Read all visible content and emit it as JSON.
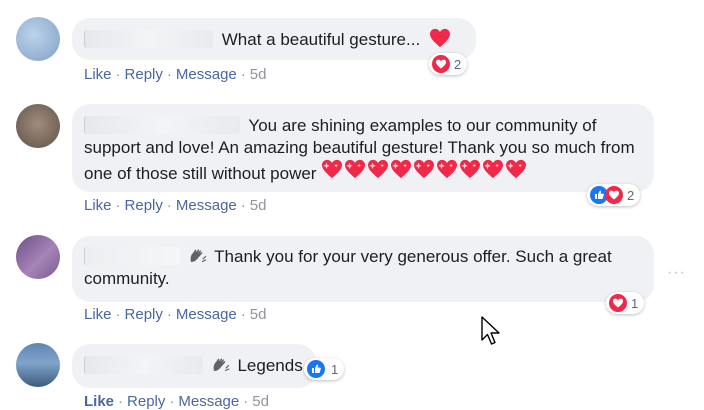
{
  "comments": [
    {
      "text": "What a beautiful gesture...",
      "actions": {
        "like": "Like",
        "reply": "Reply",
        "message": "Message",
        "time": "5d"
      },
      "reaction_count": "2"
    },
    {
      "text": "You are shining examples to our community of support and love! An amazing beautiful gesture! Thank you so much from one of those still without power",
      "actions": {
        "like": "Like",
        "reply": "Reply",
        "message": "Message",
        "time": "5d"
      },
      "reaction_count": "2"
    },
    {
      "text": "Thank you for your very generous offer. Such a great community.",
      "actions": {
        "like": "Like",
        "reply": "Reply",
        "message": "Message",
        "time": "5d"
      },
      "reaction_count": "1"
    },
    {
      "text": "Legends",
      "actions": {
        "like": "Like",
        "reply": "Reply",
        "message": "Message",
        "time": "5d"
      },
      "reaction_count": "1"
    }
  ],
  "icons": {
    "heart": "heart-icon",
    "sparkling_heart": "sparkling-heart-icon",
    "like": "like-thumb-icon",
    "clap": "raised-hands-icon",
    "more": "more-options-icon",
    "cursor": "mouse-cursor-icon"
  },
  "colors": {
    "bubble": "#eff1f4",
    "link": "#4b67a1",
    "love": "#f0284a",
    "like": "#1877f2",
    "muted": "#90949c"
  }
}
